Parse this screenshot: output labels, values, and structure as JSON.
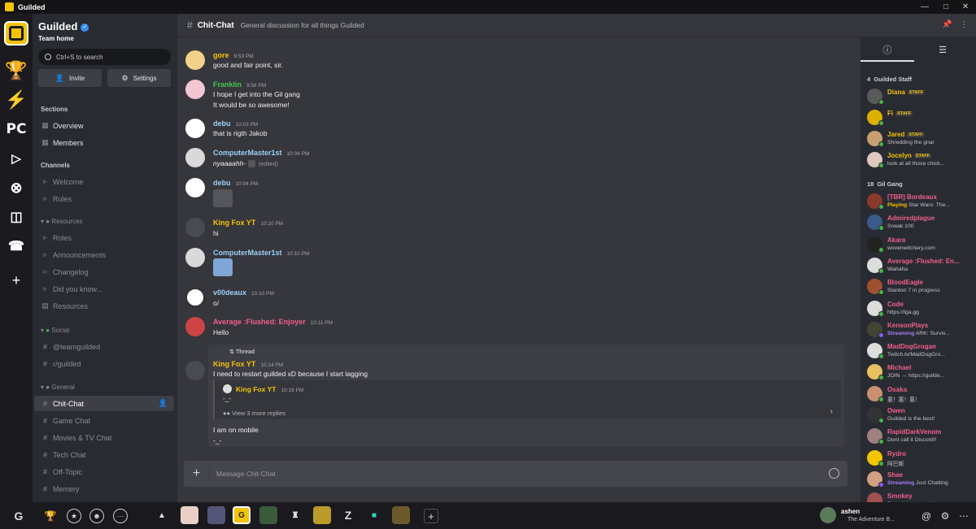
{
  "window": {
    "title": "Guilded"
  },
  "team": {
    "name": "Guilded",
    "subtitle": "Team home",
    "search_placeholder": "Ctrl+S to search",
    "invite_label": "Invite",
    "settings_label": "Settings"
  },
  "sidebar": {
    "sections_label": "Sections",
    "sections": [
      "Overview",
      "Members"
    ],
    "channels_label": "Channels",
    "channels": [
      "Welcome",
      "Rules"
    ],
    "resources_group": "Resources",
    "resources": [
      "Roles",
      "Announcements",
      "Changelog",
      "Did you know...",
      "Resources"
    ],
    "social_group": "Social",
    "social": [
      "@teamguilded",
      "r/guilded"
    ],
    "general_group": "General",
    "general": [
      "Chit-Chat",
      "Game Chat",
      "Movies & TV Chat",
      "Tech Chat",
      "Off-Topic",
      "Memery"
    ]
  },
  "header": {
    "channel": "Chit-Chat",
    "topic": "General discussion for all things Guilded"
  },
  "messages": [
    {
      "author": "gore",
      "color": "#f5c400",
      "time": "9:53 PM",
      "lines": [
        "good and fair point, sir."
      ]
    },
    {
      "author": "Franklin",
      "color": "#44c94f",
      "time": "9:56 PM",
      "lines": [
        "I hope I get into the Gil gang",
        "It would be so awesome!"
      ]
    },
    {
      "author": "debu",
      "color": "#9bd0f5",
      "time": "10:03 PM",
      "lines": [
        "that is rigth Jakob"
      ]
    },
    {
      "author": "ComputerMaster1st",
      "color": "#9bd0f5",
      "time": "10:04 PM",
      "lines": [
        "nyaaaahh-"
      ],
      "edited": "(edited)"
    },
    {
      "author": "debu",
      "color": "#9bd0f5",
      "time": "10:04 PM",
      "lines": []
    },
    {
      "author": "King Fox YT",
      "color": "#f5c400",
      "time": "10:10 PM",
      "lines": [
        "hi"
      ]
    },
    {
      "author": "ComputerMaster1st",
      "color": "#9bd0f5",
      "time": "10:10 PM",
      "lines": []
    },
    {
      "author": "v00deaux",
      "color": "#9bd0f5",
      "time": "10:10 PM",
      "lines": [
        "o/"
      ]
    },
    {
      "author": "Average :Flushed: Enjoyer",
      "color": "#f0608a",
      "time": "10:11 PM",
      "lines": [
        "Hello"
      ]
    }
  ],
  "thread": {
    "label": "Thread",
    "author": "King Fox YT",
    "time": "10:14 PM",
    "text": "I need to restart guilded xD because I start lagging",
    "reply_author": "King Fox YT",
    "reply_time": "10:18 PM",
    "reply_text": "-_-",
    "more_replies": "View 3 more replies",
    "after_lines": [
      "I am on mobile",
      "-_-"
    ]
  },
  "composer": {
    "placeholder": "Message Chit-Chat"
  },
  "members_panel": {
    "staff_group": "Guilded Staff",
    "staff_count": "4",
    "staff": [
      {
        "name": "Diana",
        "status": "",
        "badge": "STAFF"
      },
      {
        "name": "Fi",
        "status": "",
        "badge": "STAFF"
      },
      {
        "name": "Jared",
        "status": "Shredding the gnar",
        "badge": "STAFF"
      },
      {
        "name": "Jocelyn",
        "status": "look at all those chick...",
        "badge": "STAFF"
      }
    ],
    "gang_group": "Gil Gang",
    "gang_count": "18",
    "gang": [
      {
        "name": "[TBR] Bordeaux",
        "color": "#f0608a",
        "status_prefix": "Playing",
        "status": "Star Wars: The..."
      },
      {
        "name": "Admiredplague",
        "color": "#f0608a",
        "status_prefix": "",
        "status": "Sneak 100"
      },
      {
        "name": "Akara",
        "color": "#f0608a",
        "status_prefix": "",
        "status": "wovenwitchery.com"
      },
      {
        "name": "Average :Flushed: En...",
        "color": "#f0608a",
        "status_prefix": "",
        "status": "Wahaha"
      },
      {
        "name": "BloodEagle",
        "color": "#f0608a",
        "status_prefix": "",
        "status": "Stanton 7 in progress"
      },
      {
        "name": "Code",
        "color": "#f0608a",
        "status_prefix": "",
        "status": "https://lga.gg"
      },
      {
        "name": "KensonPlays",
        "color": "#f0608a",
        "status_prefix": "Streaming",
        "status": "ARK: Surviv..."
      },
      {
        "name": "MadDogGrogan",
        "color": "#f0608a",
        "status_prefix": "",
        "status": "Twitch.tv/MadDogGro..."
      },
      {
        "name": "Michael",
        "color": "#f0608a",
        "status_prefix": "",
        "status": "JOIN → https://guilde..."
      },
      {
        "name": "Osaka",
        "color": "#f0608a",
        "status_prefix": "",
        "status": "悪！悪！悪！"
      },
      {
        "name": "Owen",
        "color": "#f0608a",
        "status_prefix": "",
        "status": "Guilded is the best!"
      },
      {
        "name": "RapidDarkVenom",
        "color": "#f0608a",
        "status_prefix": "",
        "status": "Dont call it Discord!!"
      },
      {
        "name": "Rydro",
        "color": "#f0608a",
        "status_prefix": "",
        "status": "阿巴斯"
      },
      {
        "name": "Shae",
        "color": "#f0608a",
        "status_prefix": "Streaming",
        "status": "Just Chatting"
      },
      {
        "name": "Smokey",
        "color": "#f0608a",
        "status_prefix": "",
        "status": "Something something"
      }
    ]
  },
  "user": {
    "name": "ashen",
    "status": "The Adventure B..."
  },
  "colors": {
    "accent": "#f5c400",
    "bg": "#36363d",
    "sidebar": "#292b32",
    "rail": "#1b1b1f"
  }
}
